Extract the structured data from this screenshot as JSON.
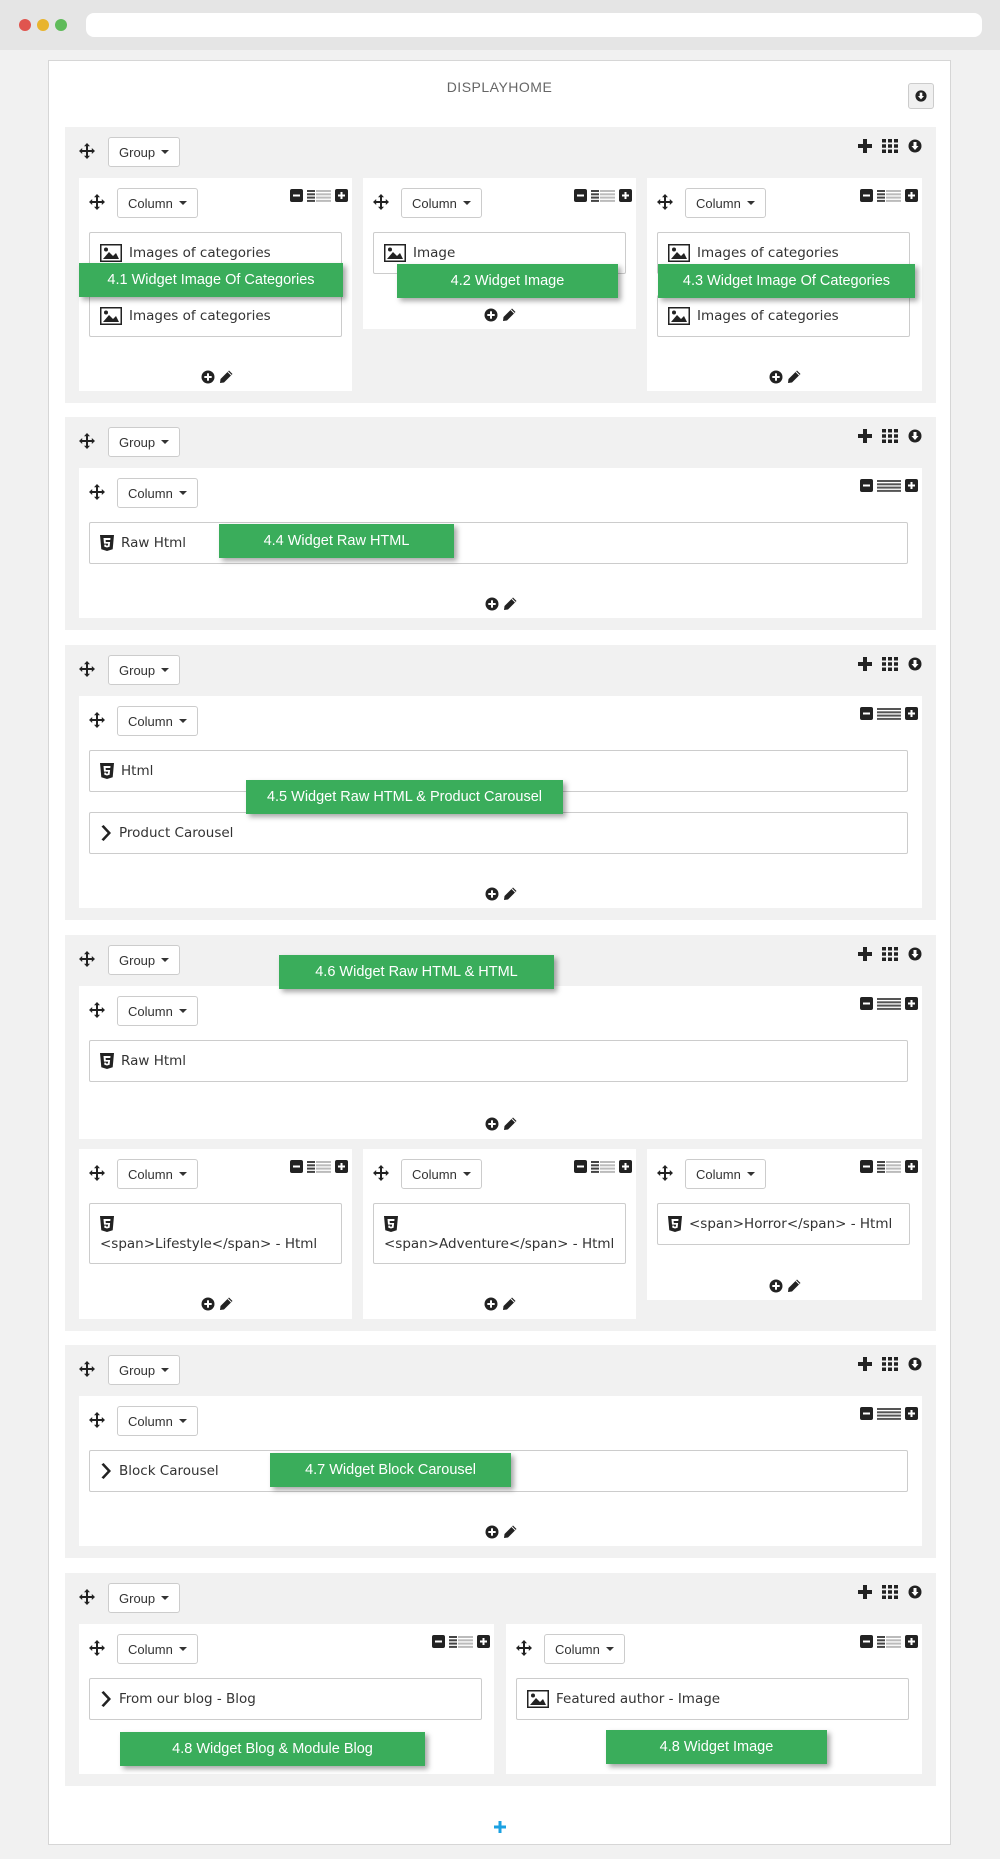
{
  "panel": {
    "title": "DISPLAYHOME"
  },
  "labels": {
    "group": "Group",
    "column": "Column"
  },
  "widgets": {
    "images_of_categories": "Images of categories",
    "image": "Image",
    "raw_html": "Raw Html",
    "html": "Html",
    "product_carousel": "Product Carousel",
    "lifestyle": "<span>Lifestyle</span> - Html",
    "adventure": "<span>Adventure</span> - Html",
    "horror": "<span>Horror</span> - Html",
    "block_carousel": "Block Carousel",
    "blog": "From our blog - Blog",
    "featured_author": "Featured author - Image"
  },
  "badges": {
    "b41": "4.1 Widget Image Of Categories",
    "b42": "4.2 Widget Image",
    "b43": "4.3 Widget Image Of Categories",
    "b44": "4.4 Widget Raw HTML",
    "b45": "4.5 Widget Raw HTML & Product Carousel",
    "b46": "4.6 Widget Raw HTML & HTML",
    "b47": "4.7 Widget Block Carousel",
    "b48a": "4.8 Widget Blog & Module Blog",
    "b48b": "4.8 Widget Image"
  },
  "icons": {
    "move": "move-icon",
    "plus": "plus-icon",
    "grid": "grid-icon",
    "collapse": "arrow-circle-down-icon",
    "minus_box": "minus-square-icon",
    "lines": "lines-icon",
    "plus_box": "plus-square-icon",
    "image": "image-icon",
    "html5": "html5-icon",
    "chevron": "chevron-right-icon",
    "add_circle": "plus-circle-icon",
    "pencil": "pencil-icon"
  },
  "colors": {
    "badge": "#3aad5b",
    "group_bg": "#f1f1f1",
    "add_group": "#1ba1e2"
  }
}
